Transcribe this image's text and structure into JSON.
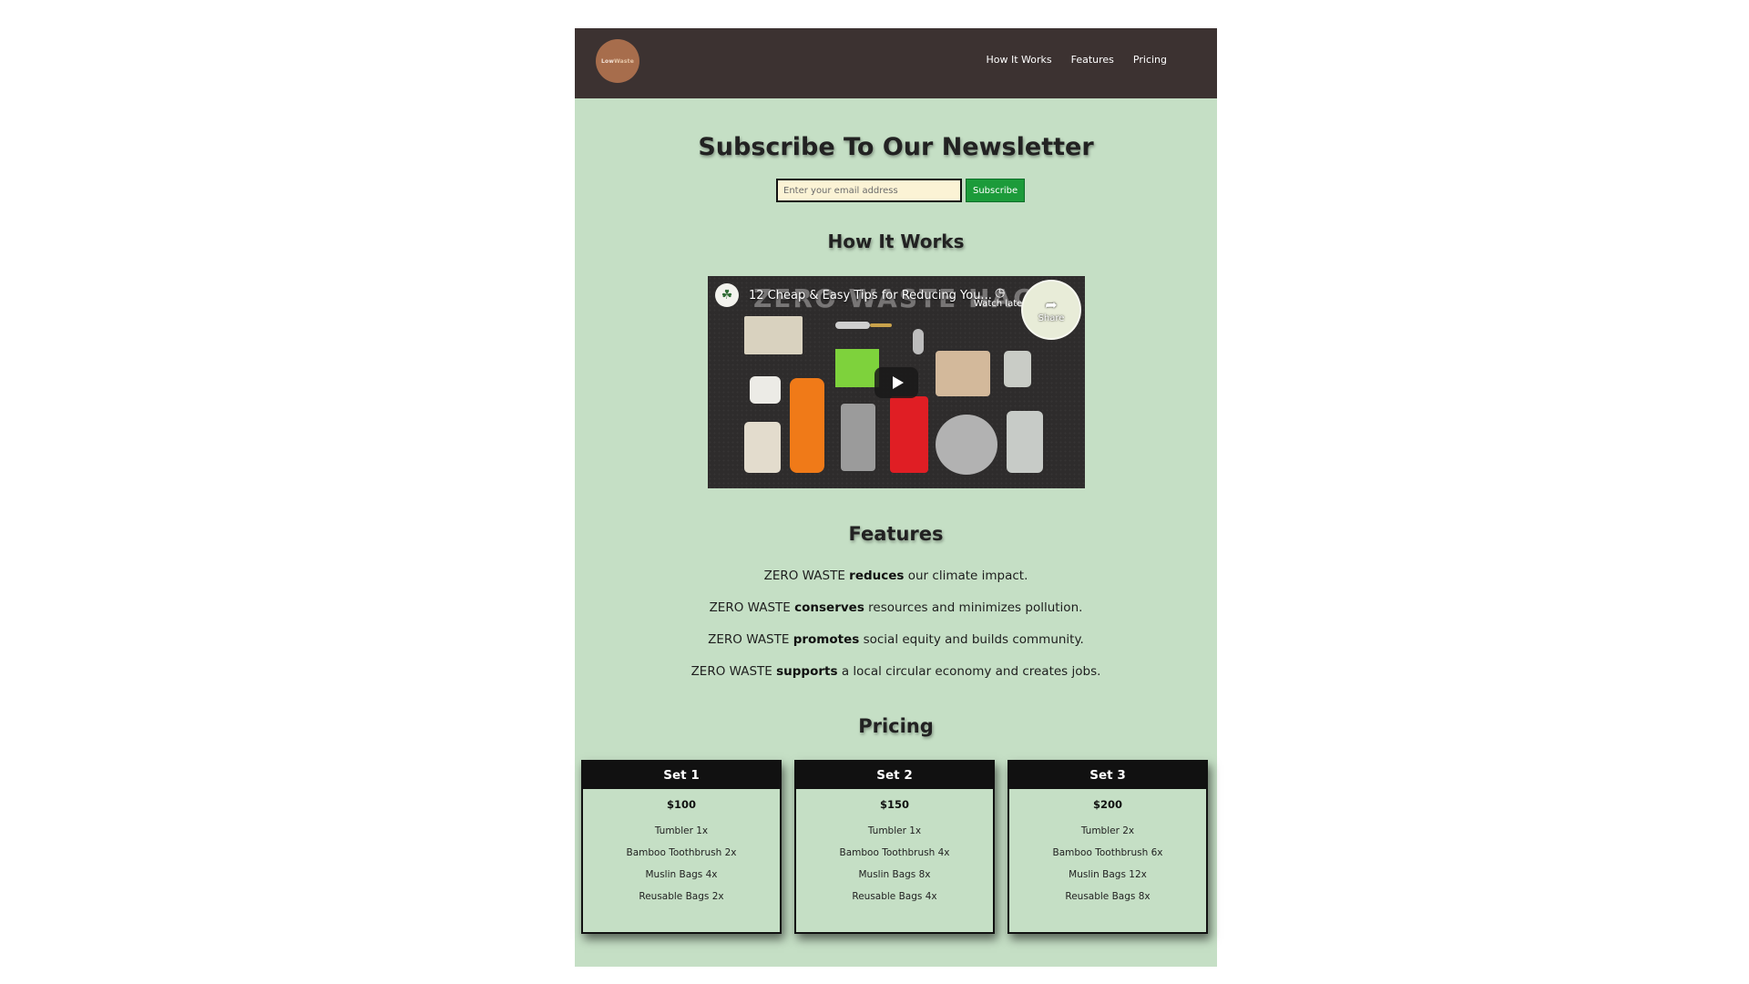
{
  "header": {
    "logo_text_1": "Low",
    "logo_text_2": "Waste",
    "nav": [
      "How It Works",
      "Features",
      "Pricing"
    ]
  },
  "newsletter": {
    "title": "Subscribe To Our Newsletter",
    "email_placeholder": "Enter your email address",
    "button_label": "Subscribe"
  },
  "how_it_works": {
    "title": "How It Works",
    "video": {
      "title": "12 Cheap & Easy Tips for Reducing You...",
      "watermark": "ZERO WASTE HACKS",
      "watch_later": "Watch later",
      "share": "Share"
    }
  },
  "features": {
    "title": "Features",
    "items": [
      {
        "prefix": "ZERO WASTE ",
        "bold": "reduces",
        "suffix": " our climate impact."
      },
      {
        "prefix": "ZERO WASTE ",
        "bold": "conserves",
        "suffix": " resources and minimizes pollution."
      },
      {
        "prefix": "ZERO WASTE ",
        "bold": "promotes",
        "suffix": " social equity and builds community."
      },
      {
        "prefix": "ZERO WASTE ",
        "bold": "supports",
        "suffix": " a local circular economy and creates jobs."
      }
    ]
  },
  "pricing": {
    "title": "Pricing",
    "sets": [
      {
        "name": "Set 1",
        "price": "$100",
        "items": [
          "Tumbler 1x",
          "Bamboo Toothbrush 2x",
          "Muslin Bags 4x",
          "Reusable Bags 2x"
        ]
      },
      {
        "name": "Set 2",
        "price": "$150",
        "items": [
          "Tumbler 1x",
          "Bamboo Toothbrush 4x",
          "Muslin Bags 8x",
          "Reusable Bags 4x"
        ]
      },
      {
        "name": "Set 3",
        "price": "$200",
        "items": [
          "Tumbler 2x",
          "Bamboo Toothbrush 6x",
          "Muslin Bags 12x",
          "Reusable Bags 8x"
        ]
      }
    ]
  },
  "colors": {
    "header_bg": "#3c3231",
    "page_bg": "#c5dfc5",
    "logo_bg": "#a76d4c",
    "subscribe_bg": "#1c9b3a",
    "card_head_bg": "#111111",
    "input_bg": "#fbf3d5"
  }
}
